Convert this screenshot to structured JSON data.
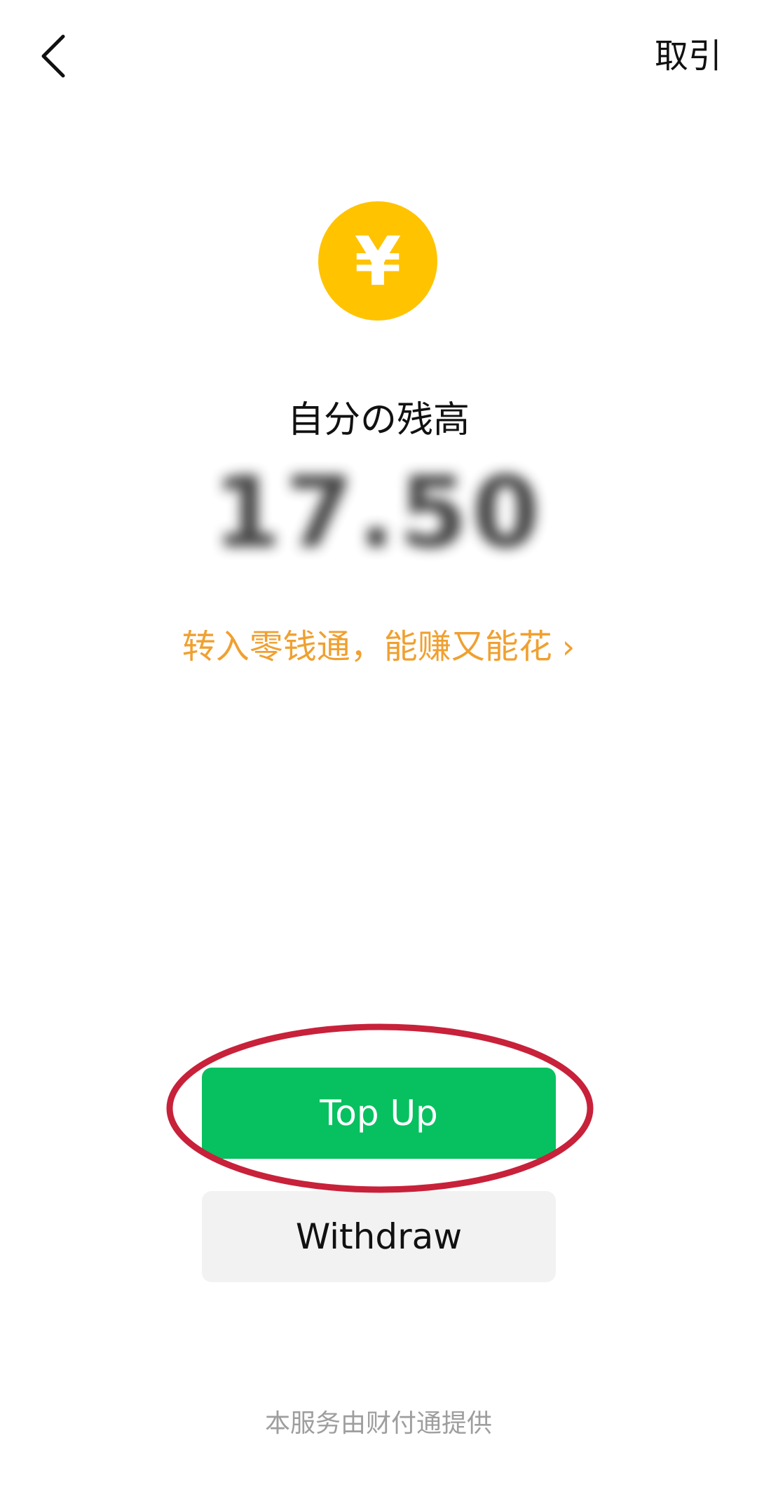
{
  "nav": {
    "back_icon": "chevron-left-icon",
    "records_label": "取引"
  },
  "wallet": {
    "coin_icon": "yen-coin-icon",
    "coin_symbol": "¥",
    "coin_color": "#FFC300",
    "balance_label": "自分の残高",
    "balance_amount": "17.50",
    "promo_text": "转入零钱通，能赚又能花",
    "promo_chevron": "›",
    "promo_color": "#F0A030"
  },
  "actions": {
    "topup_label": "Top Up",
    "topup_color": "#07C160",
    "withdraw_label": "Withdraw",
    "highlight_color": "#C8213A"
  },
  "footer": {
    "note": "本服务由财付通提供"
  }
}
